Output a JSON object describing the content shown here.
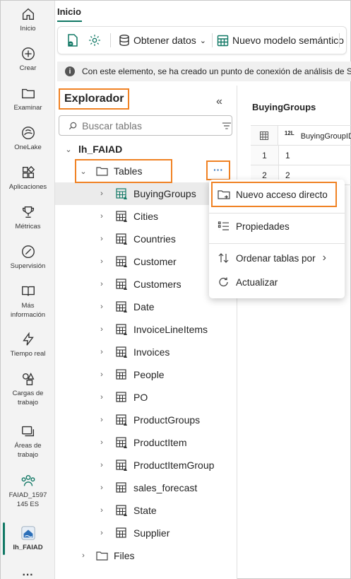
{
  "rail": {
    "items": [
      {
        "label": "Inicio",
        "icon": "home-icon"
      },
      {
        "label": "Crear",
        "icon": "plus-circle-icon"
      },
      {
        "label": "Examinar",
        "icon": "folder-icon"
      },
      {
        "label": "OneLake",
        "icon": "onelake-icon"
      },
      {
        "label": "Aplicaciones",
        "icon": "apps-icon"
      },
      {
        "label": "Métricas",
        "icon": "trophy-icon"
      },
      {
        "label": "Supervisión",
        "icon": "monitor-icon"
      },
      {
        "label": "Más información",
        "icon": "book-icon"
      },
      {
        "label": "Tiempo real",
        "icon": "lightning-icon"
      },
      {
        "label": "Cargas de trabajo",
        "icon": "shapes-icon"
      },
      {
        "label": "Áreas de trabajo",
        "icon": "workspaces-icon"
      },
      {
        "label": "FAIAD_1597 145 ES",
        "icon": "workspace-people-icon"
      },
      {
        "label": "lh_FAIAD",
        "icon": "lakehouse-icon"
      },
      {
        "label": "···",
        "icon": "more-icon"
      }
    ]
  },
  "header": {
    "tab": "Inicio",
    "toolbar": {
      "get_data": "Obtener datos",
      "new_model": "Nuevo modelo semántico"
    },
    "info": "Con este elemento, se ha creado un punto de conexión de análisis de SQL"
  },
  "explorer": {
    "title": "Explorador",
    "search_placeholder": "Buscar tablas",
    "lakehouse": "lh_FAIAD",
    "tables_folder": "Tables",
    "tables": [
      {
        "name": "BuyingGroups",
        "type": "delta"
      },
      {
        "name": "Cities",
        "type": "delta"
      },
      {
        "name": "Countries",
        "type": "delta"
      },
      {
        "name": "Customer",
        "type": "delta"
      },
      {
        "name": "Customers",
        "type": "delta"
      },
      {
        "name": "Date",
        "type": "delta"
      },
      {
        "name": "InvoiceLineItems",
        "type": "delta"
      },
      {
        "name": "Invoices",
        "type": "delta"
      },
      {
        "name": "People",
        "type": "table"
      },
      {
        "name": "PO",
        "type": "table"
      },
      {
        "name": "ProductGroups",
        "type": "delta"
      },
      {
        "name": "ProductItem",
        "type": "delta"
      },
      {
        "name": "ProductItemGroup",
        "type": "delta"
      },
      {
        "name": "sales_forecast",
        "type": "table"
      },
      {
        "name": "State",
        "type": "delta"
      },
      {
        "name": "Supplier",
        "type": "table"
      }
    ],
    "files_folder": "Files",
    "more_label": "···"
  },
  "preview": {
    "title": "BuyingGroups",
    "column_type": "12L",
    "column_name": "BuyingGroupID",
    "rows": [
      {
        "n": "1",
        "value": "1"
      },
      {
        "n": "2",
        "value": "2"
      }
    ]
  },
  "context_menu": {
    "items": [
      "Nuevo acceso directo",
      "Propiedades",
      "Ordenar tablas por",
      "Actualizar"
    ]
  },
  "colors": {
    "accent": "#117865",
    "highlight": "#f08224"
  }
}
